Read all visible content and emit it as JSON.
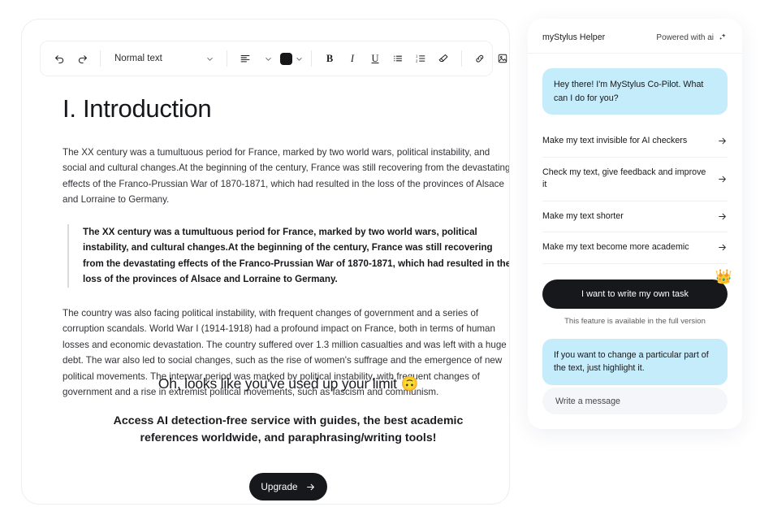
{
  "editor": {
    "toolbar": {
      "undo_icon": "undo-icon",
      "redo_icon": "redo-icon",
      "style_value": "Normal text",
      "align_icon": "align-left-icon",
      "color_value": "#17171a",
      "bold_label": "B",
      "italic_label": "I",
      "underline_label": "U",
      "bullet_list_icon": "bullet-list-icon",
      "numbered_list_icon": "numbered-list-icon",
      "clear_format_icon": "eraser-icon",
      "link_icon": "link-icon",
      "image_icon": "image-icon",
      "quote_label": "“"
    },
    "document": {
      "heading": "I. Introduction",
      "paragraph1": "The XX century was a tumultuous period for France, marked by two world wars, political instability, and social and cultural changes.At the beginning of the century, France was still recovering from the devastating effects of the Franco-Prussian War of 1870-1871, which had resulted in the loss of the provinces of Alsace and Lorraine to Germany.",
      "blockquote": "The XX century was a tumultuous period for France, marked by two world wars, political instability, and cultural changes.At the beginning of the century, France was still recovering from the devastating effects of the Franco-Prussian War of 1870-1871, which had resulted in the loss of the provinces of Alsace and Lorraine to Germany.",
      "paragraph2": "The country was also facing political instability, with frequent changes of government and a series of corruption scandals. World War I (1914-1918) had a profound impact on France, both in terms of human losses and economic devastation. The country suffered over 1.3 million casualties and was left with a huge debt. The war also led to social changes, such as the rise of women's suffrage and the emergence of new political movements. The interwar period was marked by political instability, with frequent changes of government and a rise in extremist political movements, such as fascism and communism."
    },
    "paywall": {
      "title": "Oh, looks like you've used up your limit 🙃",
      "subtitle": "Access AI detection-free service with guides, the best academic references worldwide, and paraphrasing/writing tools!",
      "upgrade_label": "Upgrade"
    }
  },
  "helper": {
    "title": "myStylus Helper",
    "powered_label": "Powered with ai",
    "powered_icon": "sparkle-icon",
    "greeting": "Hey there! I'm MyStylus Co-Pilot. What can I do for you?",
    "suggestions": [
      {
        "label": "Make my text invisible for AI checkers"
      },
      {
        "label": "Check my text, give feedback and improve it"
      },
      {
        "label": "Make my text shorter"
      },
      {
        "label": "Make my text become more academic"
      }
    ],
    "own_task_label": "I want to write my own task",
    "crown_icon": "👑",
    "full_version_note": "This feature is available in the full version",
    "highlight_tip": "If you want to change a particular part of the text, just highlight it.",
    "input_placeholder": "Write a message",
    "input_value": ""
  },
  "colors": {
    "bubble": "#c5ecfb",
    "dark_button": "#17181b",
    "input_bg": "#f4f6f9"
  }
}
